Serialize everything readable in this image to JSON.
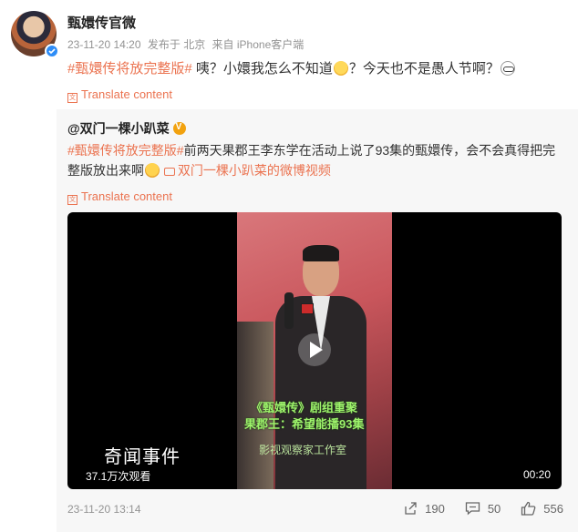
{
  "post": {
    "author": "甄嬛传官微",
    "time": "23-11-20 14:20",
    "location": "发布于 北京",
    "source": "来自 iPhone客户端",
    "hashtag": "#甄嬛传将放完整版#",
    "text_part1": " 咦？小嬛我怎么不知道",
    "text_part2": "？今天也不是愚人节啊？",
    "translate_label": "Translate content"
  },
  "repost": {
    "author": "@双门一棵小趴菜",
    "hashtag": "#甄嬛传将放完整版#",
    "text": "前两天果郡王李东学在活动上说了93集的甄嬛传，会不会真得把完整版放出来啊",
    "video_link": "双门一棵小趴菜的微博视频",
    "translate_label": "Translate content",
    "video": {
      "subtitle_line1": "《甄嬛传》剧组重聚",
      "subtitle_line2": "果郡王：希望能播93集",
      "subtitle_line3": "影视观察家工作室",
      "watermark": "奇闻事件",
      "views": "37.1万次观看",
      "duration": "00:20"
    },
    "time": "23-11-20 13:14",
    "shares": "190",
    "comments": "50",
    "likes": "556"
  },
  "colors": {
    "accent": "#eb7350",
    "verified_blue": "#2e8df7",
    "verified_gold": "#f2a20f",
    "repost_bg": "#f7f7f7"
  },
  "icons": [
    "verified-badge-icon",
    "translate-icon",
    "thinking-emoji-icon",
    "glasses-emoji-icon",
    "grin-emoji-icon",
    "video-camera-icon",
    "play-icon",
    "share-icon",
    "comment-icon",
    "like-icon"
  ]
}
